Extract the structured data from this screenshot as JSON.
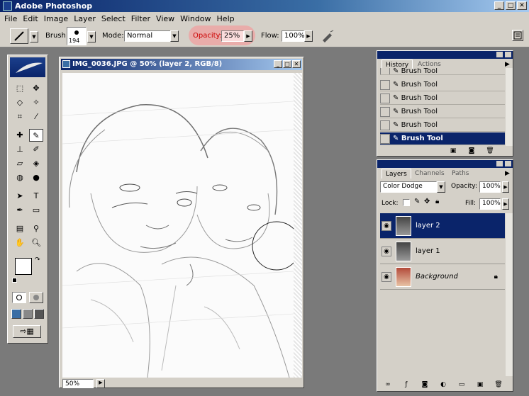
{
  "app": {
    "title": "Adobe Photoshop"
  },
  "window_controls": {
    "minimize": "_",
    "maximize": "□",
    "close": "✕"
  },
  "menu": [
    "File",
    "Edit",
    "Image",
    "Layer",
    "Select",
    "Filter",
    "View",
    "Window",
    "Help"
  ],
  "options": {
    "brush_label": "Brush:",
    "brush_size": "194",
    "mode_label": "Mode:",
    "mode_value": "Normal",
    "opacity_label": "Opacity:",
    "opacity_value": "25%",
    "flow_label": "Flow:",
    "flow_value": "100%"
  },
  "document": {
    "title": "IMG_0036.JPG @ 50% (layer 2, RGB/8)",
    "zoom": "50%"
  },
  "history": {
    "tabs": [
      "History",
      "Actions"
    ],
    "items": [
      "Brush Tool",
      "Brush Tool",
      "Brush Tool",
      "Brush Tool",
      "Brush Tool",
      "Brush Tool"
    ],
    "selected_index": 5
  },
  "layers": {
    "tabs": [
      "Layers",
      "Channels",
      "Paths"
    ],
    "blend_mode": "Color Dodge",
    "opacity_label": "Opacity:",
    "opacity_value": "100%",
    "lock_label": "Lock:",
    "fill_label": "Fill:",
    "fill_value": "100%",
    "items": [
      {
        "name": "layer 2",
        "selected": true
      },
      {
        "name": "layer 1",
        "selected": false
      },
      {
        "name": "Background",
        "selected": false,
        "locked": true
      }
    ]
  },
  "colors": {
    "accent": "#0a246a",
    "chrome": "#d4d0c8",
    "highlight": "#f0a0a0"
  }
}
